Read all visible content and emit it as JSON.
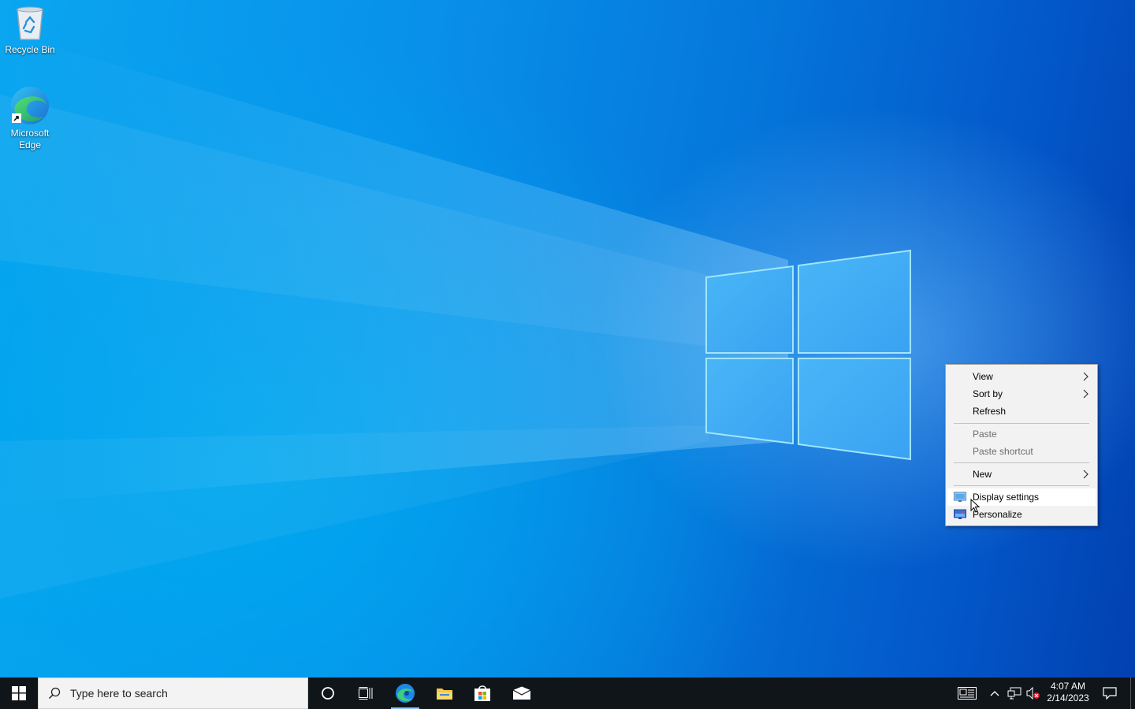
{
  "desktop": {
    "icons": [
      {
        "label": "Recycle Bin",
        "icon": "recycle-bin-icon"
      },
      {
        "label": "Microsoft Edge",
        "icon": "edge-icon"
      }
    ]
  },
  "context_menu": {
    "items": [
      {
        "label": "View",
        "submenu": true,
        "enabled": true
      },
      {
        "label": "Sort by",
        "submenu": true,
        "enabled": true
      },
      {
        "label": "Refresh",
        "submenu": false,
        "enabled": true
      },
      {
        "label": "Paste",
        "submenu": false,
        "enabled": false
      },
      {
        "label": "Paste shortcut",
        "submenu": false,
        "enabled": false
      },
      {
        "label": "New",
        "submenu": true,
        "enabled": true
      },
      {
        "label": "Display settings",
        "submenu": false,
        "enabled": true,
        "hovered": true,
        "icon": "display-settings-icon"
      },
      {
        "label": "Personalize",
        "submenu": false,
        "enabled": true,
        "icon": "personalize-icon"
      }
    ]
  },
  "taskbar": {
    "search_placeholder": "Type here to search",
    "apps": [
      "cortana-icon",
      "task-view-icon",
      "edge-icon",
      "file-explorer-icon",
      "store-icon",
      "mail-icon"
    ],
    "active_app": "edge-icon",
    "tray": [
      "news-icon",
      "chevron-up-icon",
      "network-icon",
      "volume-muted-icon"
    ],
    "clock_time": "4:07 AM",
    "clock_date": "2/14/2023"
  },
  "colors": {
    "taskbar_bg": "#101519",
    "menu_bg": "#f2f2f2",
    "accent": "#0078d7"
  }
}
